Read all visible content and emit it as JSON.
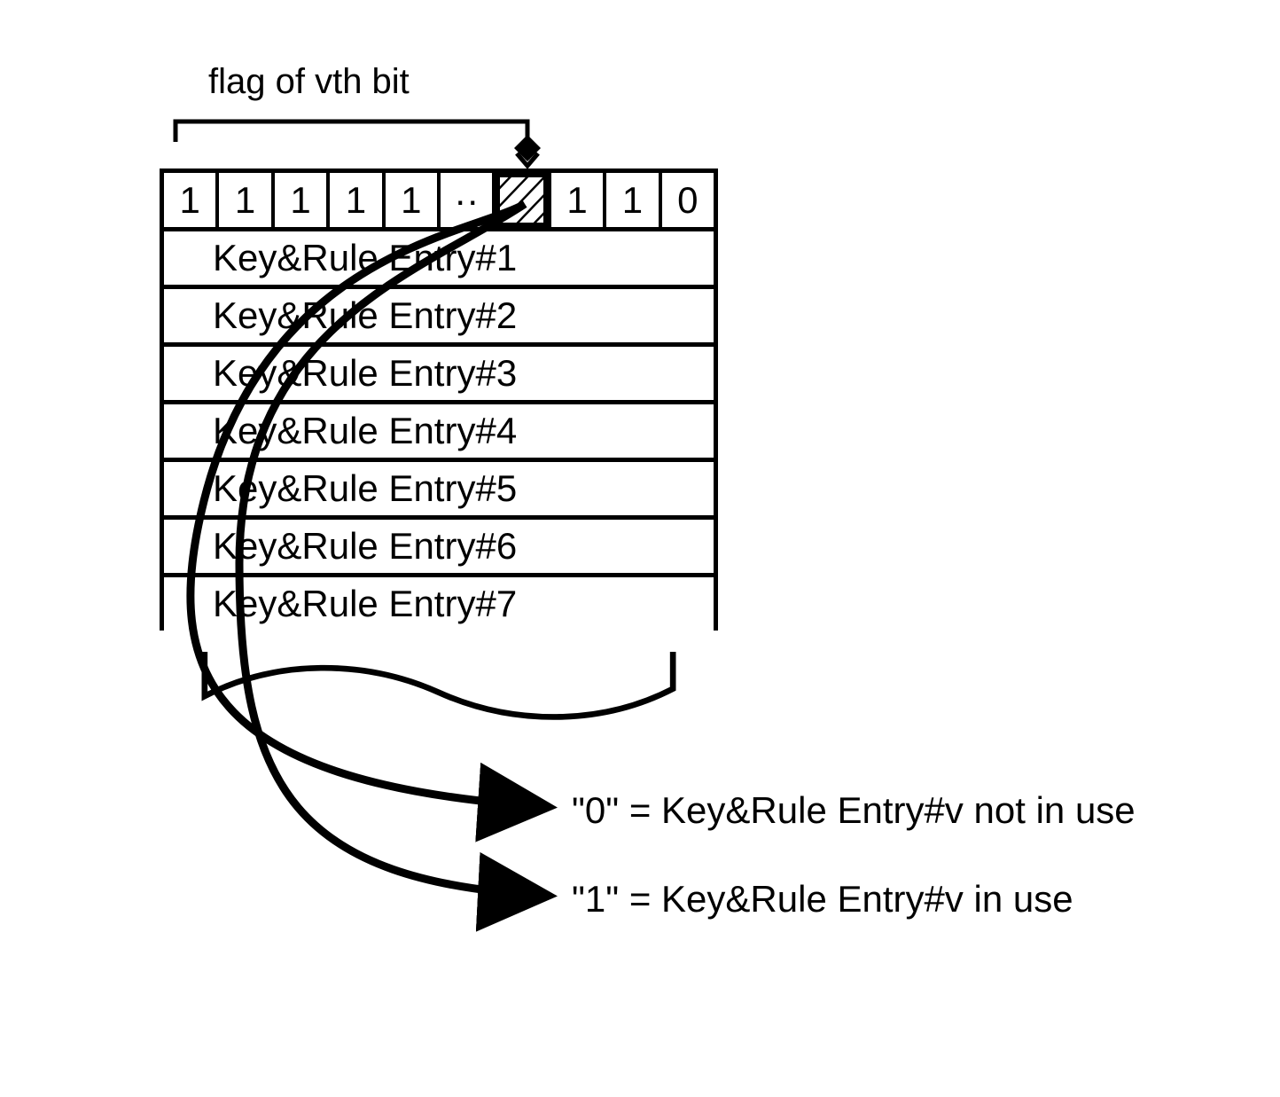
{
  "flag_label": "flag of vth bit",
  "bits": [
    "1",
    "1",
    "1",
    "1",
    "1",
    "··",
    "",
    "1",
    "1",
    "0"
  ],
  "hatched_index": 6,
  "entries": [
    "Key&Rule Entry#1",
    "Key&Rule Entry#2",
    "Key&Rule Entry#3",
    "Key&Rule Entry#4",
    "Key&Rule Entry#5",
    "Key&Rule Entry#6",
    "Key&Rule Entry#7"
  ],
  "legend_zero": "\"0\" = Key&Rule Entry#v not in use",
  "legend_one": "\"1\" = Key&Rule Entry#v in use"
}
